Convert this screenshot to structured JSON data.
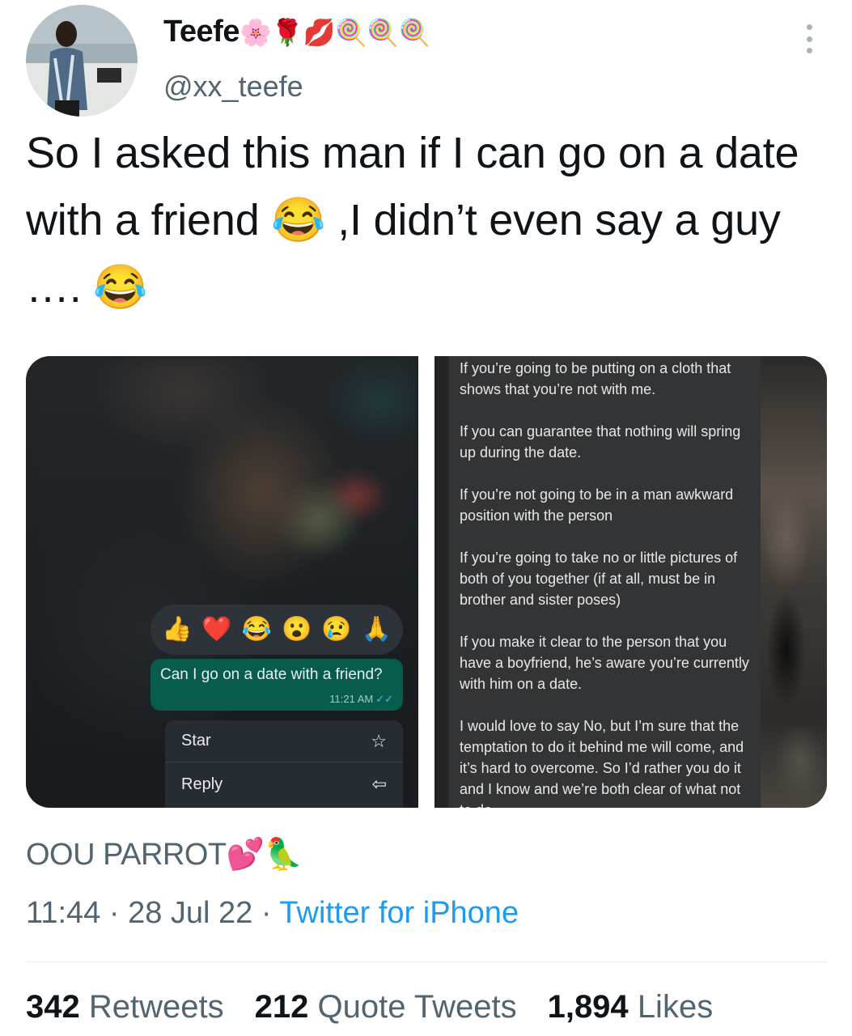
{
  "author": {
    "name": "Teefe",
    "name_emojis": "🌸🌹💋🍭🍭🍭",
    "handle": "@xx_teefe"
  },
  "tweet": {
    "text": "So I asked this man if I can go on a date with a friend 😂 ,I didn’t even say a guy …. 😂"
  },
  "media": {
    "left": {
      "reactions": [
        "👍",
        "❤️",
        "😂",
        "😮",
        "😢",
        "🙏"
      ],
      "message_text": "Can I go on a date with a friend?",
      "message_time": "11:21 AM",
      "menu_star": "Star",
      "menu_reply": "Reply"
    },
    "right": {
      "paragraphs": [
        "If you’re going to be putting on a cloth that shows that you’re not with me.",
        "If you can guarantee that nothing will spring up during the date.",
        "If you’re not going to be in a man awkward position with the person",
        "If you’re going to take no or little pictures of both of you together (if at all, must be in brother and sister poses)",
        "If you make it clear to the person that you have a boyfriend, he’s aware you’re currently with him on a date.",
        "I would love to say No, but I’m sure that the temptation to do it behind me will come, and it’s hard to overcome. So I’d rather you do it and I know and we’re both clear of what not to do"
      ]
    }
  },
  "source": {
    "name": "OOU PARROT",
    "emojis": "💕🦜"
  },
  "meta": {
    "time": "11:44",
    "separator": "·",
    "date": "28 Jul 22",
    "client": "Twitter for iPhone"
  },
  "stats": {
    "retweets_count": "342",
    "retweets_label": "Retweets",
    "quotes_count": "212",
    "quotes_label": "Quote Tweets",
    "likes_count": "1,894",
    "likes_label": "Likes"
  }
}
